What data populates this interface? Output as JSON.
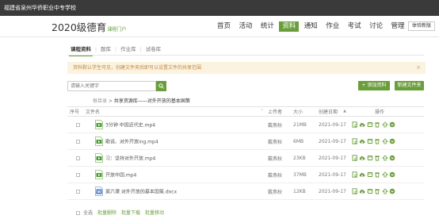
{
  "topbar": {
    "school": "福建省泉州华侨职业中专学校"
  },
  "brand": {
    "year": "2020级德育",
    "portal": "课程门户"
  },
  "nav": {
    "items": [
      {
        "label": "首页"
      },
      {
        "label": "活动"
      },
      {
        "label": "统计"
      },
      {
        "label": "资料",
        "active": true
      },
      {
        "label": "通知"
      },
      {
        "label": "作业"
      },
      {
        "label": "考试"
      },
      {
        "label": "讨论"
      },
      {
        "label": "管理"
      }
    ],
    "version_button": "体验新版"
  },
  "subtabs": {
    "items": [
      {
        "label": "课程资料",
        "active": true
      },
      {
        "label": "题库"
      },
      {
        "label": "作业库"
      },
      {
        "label": "试卷库"
      }
    ]
  },
  "notice": {
    "text": "资料默认学生可见，创建文件夹后即可以设置文件的共享范围",
    "close": "×"
  },
  "search": {
    "placeholder": "请输入关键字"
  },
  "actions": {
    "add_label": "+ 添加资料",
    "newfolder_label": "新建文件夹"
  },
  "breadcrumb": {
    "root": "根目录",
    "sep": ">",
    "current": "共享资源库——对外开放的基本国策"
  },
  "table": {
    "headers": {
      "seq": "序号",
      "name": "文件名",
      "uploader": "上传者",
      "size": "大小",
      "date": "创建日期",
      "ops": "操作"
    },
    "date_sort": "▲",
    "name_sort": "⌃",
    "rows": [
      {
        "name": "3分钟 中国近代史.mp4",
        "uploader": "戴燕秋",
        "size": "21MB",
        "date": "2021-09-17",
        "type": "video"
      },
      {
        "name": "歌说、对外开放ing.mp4",
        "uploader": "戴燕秋",
        "size": "6MB",
        "date": "2021-09-17",
        "type": "video"
      },
      {
        "name": "习：坚持对外开放.mp4",
        "uploader": "戴燕秋",
        "size": "23KB",
        "date": "2021-09-17",
        "type": "video"
      },
      {
        "name": "开放中国.mp4",
        "uploader": "戴燕秋",
        "size": "37MB",
        "date": "2021-09-17",
        "type": "video"
      },
      {
        "name": "第六课 对外开放的基本国策.docx",
        "uploader": "戴燕秋",
        "size": "12KB",
        "date": "2021-09-17",
        "type": "doc"
      }
    ]
  },
  "footer": {
    "select_all": "全选",
    "batch_delete": "批量删除",
    "batch_download": "批量下载",
    "batch_move": "批量移动"
  },
  "colors": {
    "accent": "#6a9e3b",
    "topbar": "#3a3a3a",
    "notice_bg": "#fbf2e0",
    "notice_text": "#c08b46"
  }
}
